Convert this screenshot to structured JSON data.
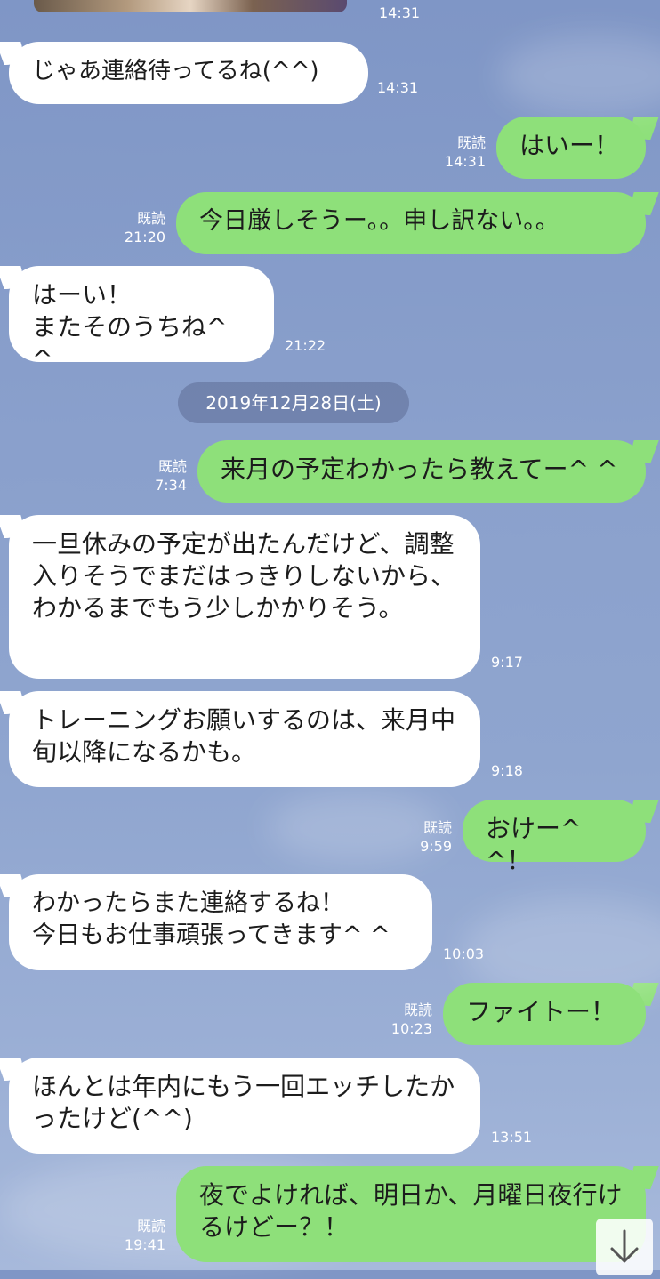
{
  "chat": {
    "date_separator": "2019年12月28日(土)",
    "messages": [
      {
        "id": "m0",
        "side": "in",
        "text": "",
        "time": "14:31",
        "read": ""
      },
      {
        "id": "m1",
        "side": "in",
        "text": "じゃあ連絡待ってるね(^^)",
        "time": "14:31",
        "read": ""
      },
      {
        "id": "m2",
        "side": "out",
        "text": "はいー！",
        "time": "14:31",
        "read": "既読"
      },
      {
        "id": "m3",
        "side": "out",
        "text": "今日厳しそうー。。申し訳ない。。",
        "time": "21:20",
        "read": "既読"
      },
      {
        "id": "m4",
        "side": "in",
        "text": "はーい！\nまたそのうちね^ ^",
        "time": "21:22",
        "read": ""
      },
      {
        "id": "m5",
        "side": "out",
        "text": "来月の予定わかったら教えてー^ ^",
        "time": "7:34",
        "read": "既読"
      },
      {
        "id": "m6",
        "side": "in",
        "text": "一旦休みの予定が出たんだけど、調整入りそうでまだはっきりしないから、わかるまでもう少しかかりそう。",
        "time": "9:17",
        "read": ""
      },
      {
        "id": "m7",
        "side": "in",
        "text": "トレーニングお願いするのは、来月中旬以降になるかも。",
        "time": "9:18",
        "read": ""
      },
      {
        "id": "m8",
        "side": "out",
        "text": "おけー^ ^！",
        "time": "9:59",
        "read": "既読"
      },
      {
        "id": "m9",
        "side": "in",
        "text": "わかったらまた連絡するね！\n今日もお仕事頑張ってきます^ ^",
        "time": "10:03",
        "read": ""
      },
      {
        "id": "m10",
        "side": "out",
        "text": "ファイトー！",
        "time": "10:23",
        "read": "既読"
      },
      {
        "id": "m11",
        "side": "in",
        "text": "ほんとは年内にもう一回エッチしたかったけど(^^)",
        "time": "13:51",
        "read": ""
      },
      {
        "id": "m12",
        "side": "out",
        "text": "夜でよければ、明日か、月曜日夜行けるけどー？！",
        "time": "19:41",
        "read": "既読"
      }
    ]
  },
  "scroll_button": {
    "icon": "arrow-down-icon",
    "glyph": "↓"
  },
  "colors": {
    "incoming_bubble": "#ffffff",
    "outgoing_bubble": "#8ee07a",
    "background": "#8aa0cc",
    "meta_text": "#ffffff"
  }
}
